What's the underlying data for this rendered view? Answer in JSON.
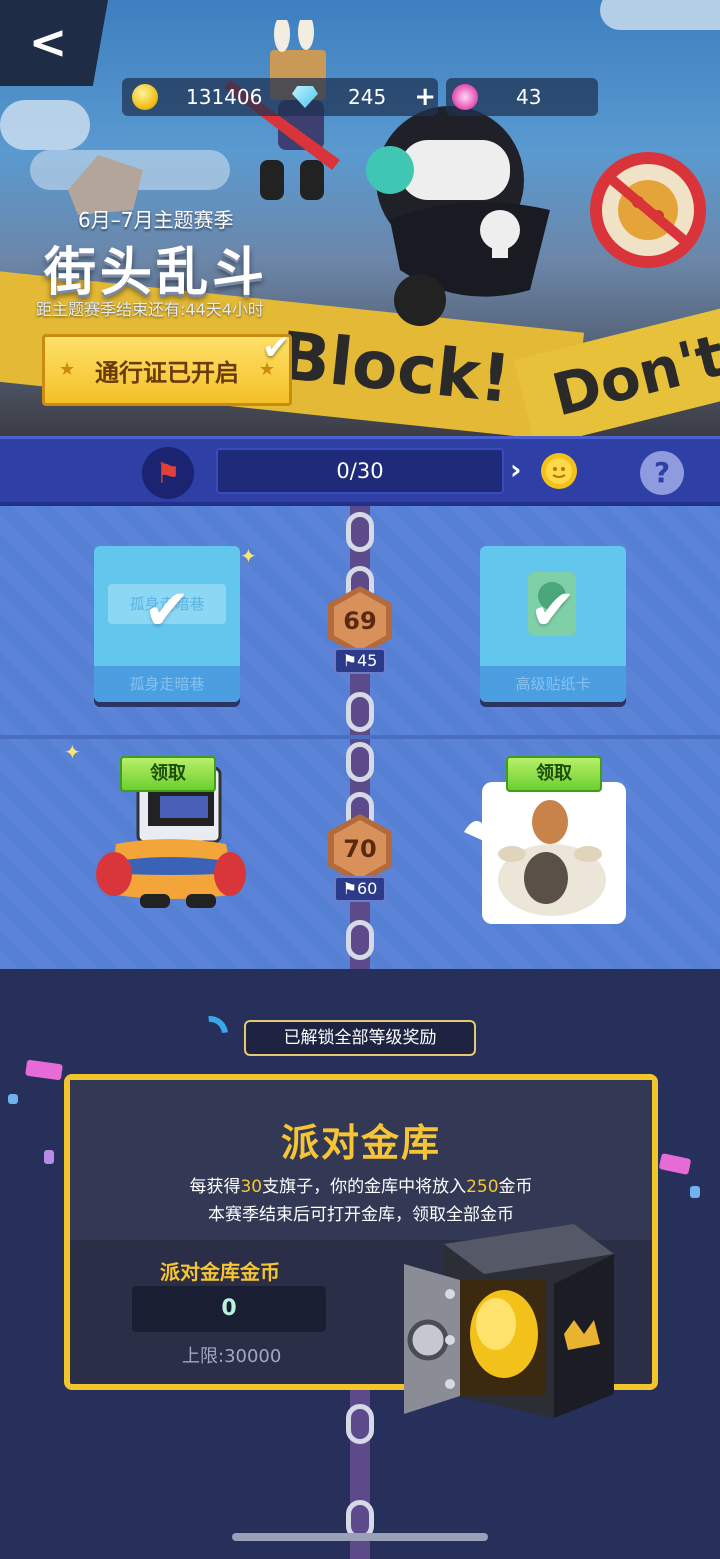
{
  "header": {
    "back_label": "<",
    "coins": "131406",
    "gems": "245",
    "gems_plus": "+",
    "lotus": "43"
  },
  "season": {
    "subtitle": "6月–7月主题赛季",
    "title": "街头乱斗",
    "remaining": "距主题赛季结束还有:44天4小时",
    "pass_button": "通行证已开启",
    "tape_words": [
      "Don't B",
      "Block!"
    ]
  },
  "progress": {
    "value": "0/30",
    "current": 0,
    "max": 30,
    "help_label": "?"
  },
  "levels": [
    {
      "level": "69",
      "requirement": "45",
      "left_reward": {
        "inner": "孤身走暗巷",
        "footer": "孤身走暗巷",
        "state": "claimed"
      },
      "right_reward": {
        "footer": "高级贴纸卡",
        "state": "claimed"
      }
    },
    {
      "level": "70",
      "requirement": "60",
      "left_reward": {
        "claim_label": "领取",
        "state": "available"
      },
      "right_reward": {
        "claim_label": "领取",
        "state": "available"
      }
    }
  ],
  "vault": {
    "unlocked_notice": "已解锁全部等级奖励",
    "title": "派对金库",
    "desc1_a": "每获得",
    "desc1_b": "30",
    "desc1_c": "支旗子，你的金库中将放入",
    "desc1_d": "250",
    "desc1_e": "金币",
    "desc2": "本赛季结束后可打开金库，领取全部金币",
    "coins_label": "派对金库金币",
    "coins_value": "0",
    "limit": "上限:30000"
  },
  "colors": {
    "accent_gold": "#f7c534",
    "bar_blue": "#2e3fa6",
    "claim_green": "#6ccf2e"
  }
}
